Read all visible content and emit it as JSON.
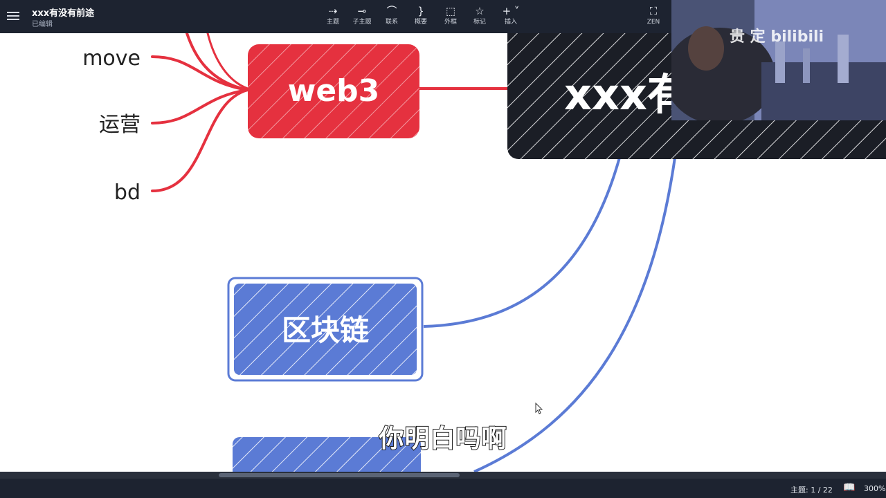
{
  "window": {
    "title": "xxx有没有前途",
    "status": "已编辑"
  },
  "toolbar": {
    "items": [
      {
        "label": "主题",
        "icon": "topic-icon"
      },
      {
        "label": "子主题",
        "icon": "subtopic-icon"
      },
      {
        "label": "联系",
        "icon": "relationship-icon"
      },
      {
        "label": "概要",
        "icon": "summary-icon"
      },
      {
        "label": "外框",
        "icon": "boundary-icon"
      },
      {
        "label": "标记",
        "icon": "marker-star-icon"
      },
      {
        "label": "插入",
        "icon": "insert-plus-icon"
      },
      {
        "label": "ZEN",
        "icon": "fullscreen-icon"
      }
    ]
  },
  "mindmap": {
    "central_topic": "xxx有",
    "web3_topic": "web3",
    "web3_subtopics": [
      "move",
      "运营",
      "bd"
    ],
    "blockchain_topic": "区块链",
    "colors": {
      "red": "#e5313f",
      "blue": "#5b7bd5",
      "dark": "#1b1e26"
    }
  },
  "overlay": {
    "subtitle": "你明白吗啊",
    "watermark": "贵 定 bilibili"
  },
  "statusbar": {
    "topic_count": "主题: 1 / 22",
    "zoom": "300%"
  }
}
